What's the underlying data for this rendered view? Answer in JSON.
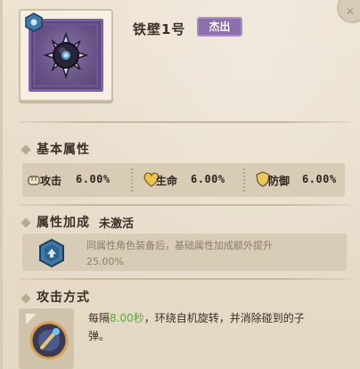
{
  "item": {
    "name": "铁壁1号",
    "rarity": "杰出",
    "rarity_color": "#8d6fae"
  },
  "sections": {
    "base_attributes": {
      "title": "基本属性",
      "stats": [
        {
          "label": "攻击",
          "value": "6.00%",
          "icon": "fist-icon"
        },
        {
          "label": "生命",
          "value": "6.00%",
          "icon": "heart-icon"
        },
        {
          "label": "防御",
          "value": "6.00%",
          "icon": "shield-icon"
        }
      ]
    },
    "bonus": {
      "title": "属性加成",
      "status": "未激活",
      "description_line1": "同属性角色装备后，基础属性加成额外提升",
      "description_line2": "25.00%"
    },
    "attack_mode": {
      "title": "攻击方式",
      "desc_prefix": "每隔",
      "desc_highlight": "8.00秒",
      "desc_suffix": "，环绕自机旋转，并消除碰到的子",
      "desc_line2": "弹。"
    }
  },
  "colors": {
    "panel_bg": "#ede3d3",
    "highlight_green": "#5aa63c",
    "item_frame_purple": "#6c5490"
  }
}
